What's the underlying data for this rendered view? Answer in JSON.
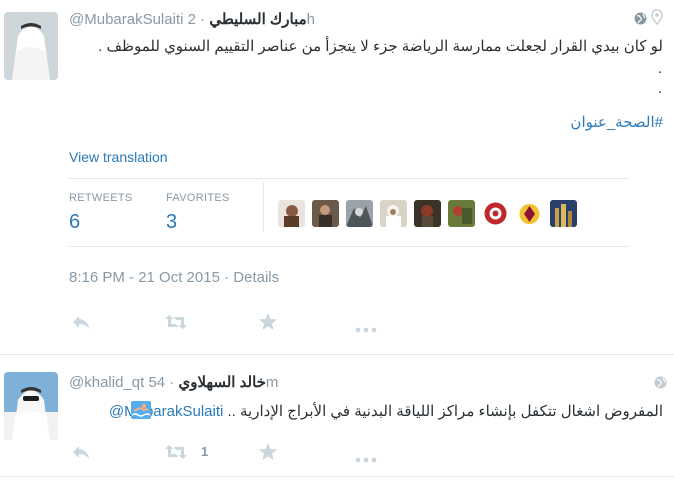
{
  "tweet1": {
    "display_name": "مبارك السليطي",
    "handle": "@MubarakSulaiti",
    "time": "· 2h",
    "text": "لو كان بيدي القرار لجعلت ممارسة الرياضة جزء لا يتجزأ من عناصر التقييم السنوي للموظف .",
    "dot1": ".",
    "dot2": ".",
    "hashtag": "#الصحة_عنوان",
    "view_translation": "View translation",
    "retweets_label": "RETWEETS",
    "retweets_count": "6",
    "favorites_label": "FAVORITES",
    "favorites_count": "3",
    "timestamp": "8:16 PM - 21 Oct 2015",
    "details_sep": " · ",
    "details_label": "Details",
    "icons": {
      "reply": "reply-icon",
      "retweet": "retweet-icon",
      "favorite": "star-icon",
      "more": "more-icon",
      "globe": "globe-icon",
      "location": "location-pin-icon"
    }
  },
  "reply": {
    "display_name": "خالد السهلاوي",
    "handle": "@khalid_qt",
    "time": "· 54m",
    "mention": "@MubarakSulaiti",
    "text": " المفروض اشغال تتكفل بإنشاء مراكز اللياقة البدنية في الأبراج الإدارية .. ",
    "retweet_count": "1",
    "emoji": "swimmer-emoji"
  },
  "colors": {
    "link": "#2b7bb9",
    "muted": "#8899a6",
    "text": "#292f33",
    "divider": "#e1e8ed"
  }
}
